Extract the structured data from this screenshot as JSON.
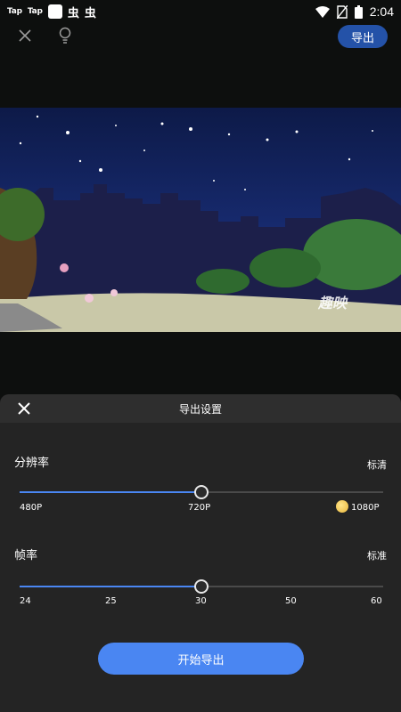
{
  "status_bar": {
    "tap1": "Tap",
    "tap2": "Tap",
    "bug1": "虫",
    "bug2": "虫",
    "time": "2:04"
  },
  "toolbar": {
    "export_label": "导出",
    "close_icon": "close-icon",
    "bulb_icon": "lightbulb-icon"
  },
  "preview": {
    "watermark": "趣映"
  },
  "sheet": {
    "title": "导出设置",
    "resolution": {
      "label": "分辨率",
      "value": "标清",
      "ticks": [
        "480P",
        "720P",
        "1080P"
      ],
      "selected_index": 1,
      "fraction": 0.5
    },
    "framerate": {
      "label": "帧率",
      "value": "标准",
      "ticks": [
        "24",
        "25",
        "30",
        "50",
        "60"
      ],
      "selected_index": 2,
      "fraction": 0.5
    },
    "start_label": "开始导出"
  },
  "colors": {
    "accent": "#4a86f2",
    "export_button": "#2452a8",
    "sheet_bg": "#242424"
  }
}
